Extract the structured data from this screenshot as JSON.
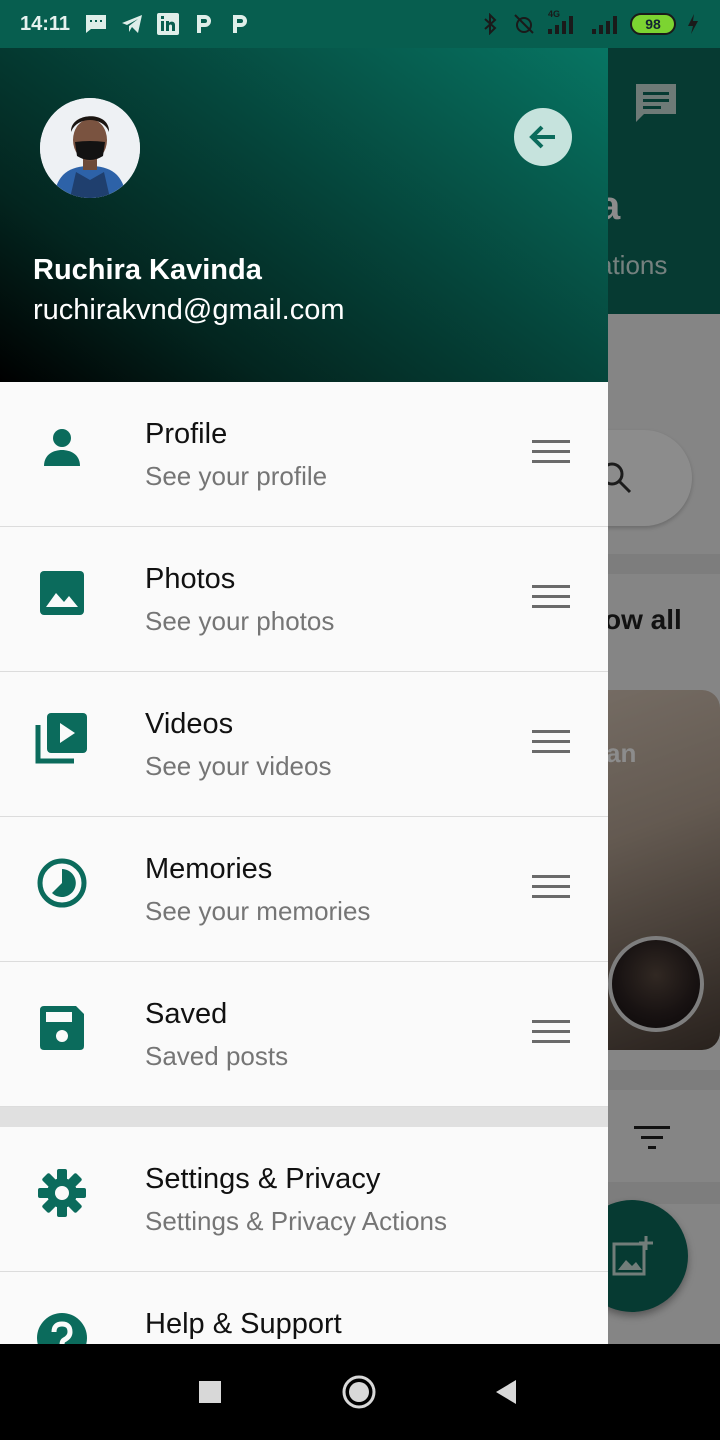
{
  "status_bar": {
    "time": "14:11",
    "left_icons": [
      "message-icon",
      "telegram-icon",
      "linkedin-icon",
      "p-app-icon",
      "p-app-icon"
    ],
    "right_icons": [
      "bluetooth-icon",
      "alarm-off-icon",
      "signal-4g-icon",
      "signal-icon",
      "charging-icon"
    ],
    "network_label": "4G",
    "battery_level": "98"
  },
  "background_app": {
    "header_partial_title": "a",
    "header_partial_subtitle": "ations",
    "show_all_partial": "ow all",
    "card_partial_text": "an"
  },
  "drawer": {
    "user": {
      "name": "Ruchira Kavinda",
      "email": "ruchirakvnd@gmail.com"
    },
    "items": [
      {
        "title": "Profile",
        "subtitle": "See your profile",
        "icon": "person-icon"
      },
      {
        "title": "Photos",
        "subtitle": "See your photos",
        "icon": "image-icon"
      },
      {
        "title": "Videos",
        "subtitle": "See your videos",
        "icon": "video-library-icon"
      },
      {
        "title": "Memories",
        "subtitle": "See your memories",
        "icon": "memories-icon"
      },
      {
        "title": "Saved",
        "subtitle": "Saved posts",
        "icon": "save-icon"
      }
    ],
    "secondary_items": [
      {
        "title": "Settings & Privacy",
        "subtitle": "Settings & Privacy Actions",
        "icon": "gear-icon"
      },
      {
        "title": "Help & Support",
        "subtitle": "",
        "icon": "help-icon"
      }
    ]
  },
  "colors": {
    "accent": "#075e4f",
    "header_gradient_end": "#077563",
    "icon_color": "#0b6b5c"
  }
}
